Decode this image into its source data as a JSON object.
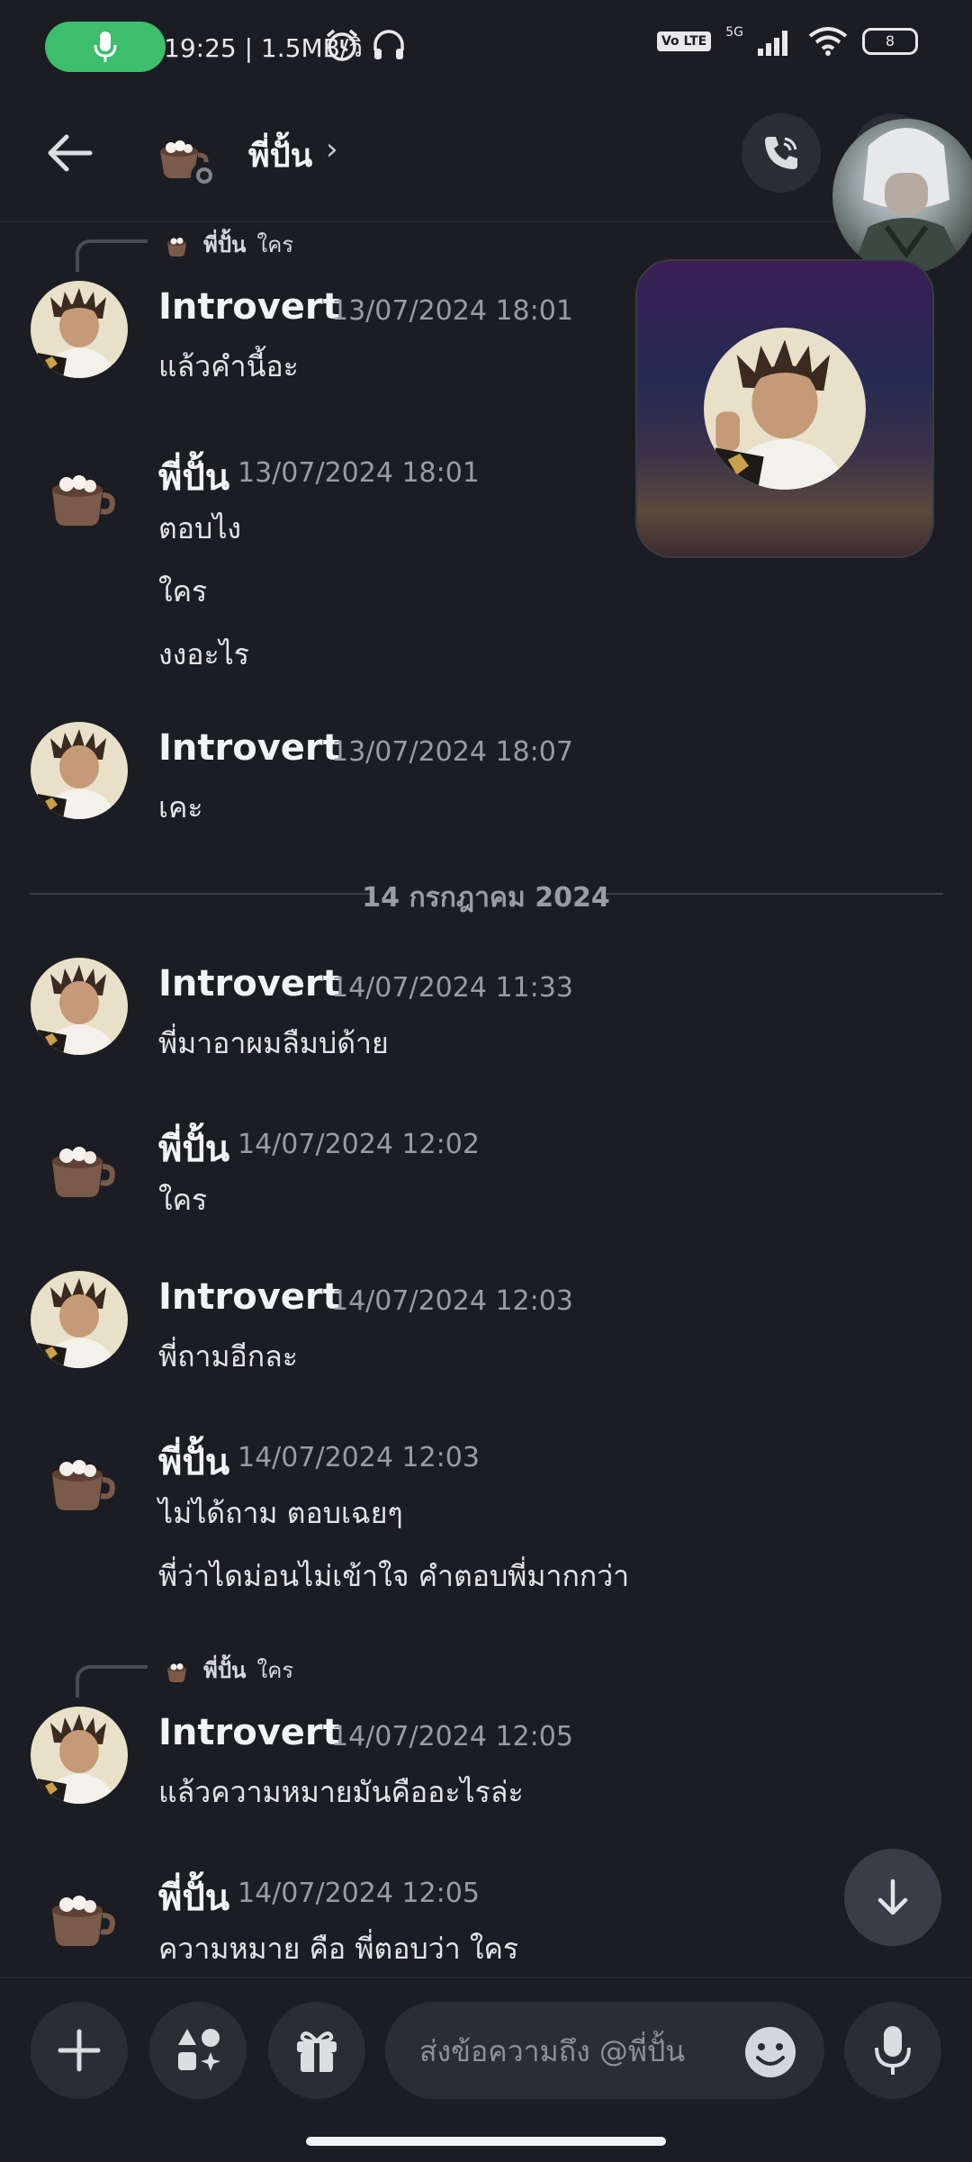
{
  "status_bar": {
    "time": "19:25 | 1.5MB/วิ",
    "network_badge": "Vo LTE",
    "network_type": "5G",
    "battery": "8"
  },
  "header": {
    "name": "พี่ปั้น",
    "chevron": "›"
  },
  "reply_refs": {
    "first": {
      "name": "พี่ปั้น",
      "text": "ใคร"
    },
    "second": {
      "name": "พี่ปั้น",
      "text": "ใคร"
    }
  },
  "messages": [
    {
      "author": "Introvert",
      "time": "13/07/2024 18:01",
      "lines": [
        "แล้วคำนี้อะ"
      ]
    },
    {
      "author": "พี่ปั้น",
      "time": "13/07/2024 18:01",
      "lines": [
        "ตอบไง",
        "ใคร",
        "งงอะไร"
      ]
    },
    {
      "author": "Introvert",
      "time": "13/07/2024 18:07",
      "lines": [
        "เคะ"
      ]
    },
    {
      "author": "Introvert",
      "time": "14/07/2024 11:33",
      "lines": [
        "พี่มาอาผมลืมบ่ด้าย"
      ]
    },
    {
      "author": "พี่ปั้น",
      "time": "14/07/2024 12:02",
      "lines": [
        "ใคร"
      ]
    },
    {
      "author": "Introvert",
      "time": "14/07/2024 12:03",
      "lines": [
        "พี่ถามอีกละ"
      ]
    },
    {
      "author": "พี่ปั้น",
      "time": "14/07/2024 12:03",
      "lines": [
        "ไม่ได้ถาม ตอบเฉยๆ",
        "พี่ว่าไดม่อนไม่เข้าใจ คำตอบพี่มากกว่า"
      ]
    },
    {
      "author": "Introvert",
      "time": "14/07/2024 12:05",
      "lines": [
        "แล้วความหมายมันคืออะไรล่ะ"
      ]
    },
    {
      "author": "พี่ปั้น",
      "time": "14/07/2024 12:05",
      "lines": [
        "ความหมาย คือ พี่ตอบว่า ใคร"
      ]
    }
  ],
  "date_divider": "14 กรกฎาคม 2024",
  "composer": {
    "placeholder": "ส่งข้อความถึง @พี่ปั้น"
  },
  "colors": {
    "background": "#1c1d22",
    "mic_active": "#3ebd6c",
    "timestamp": "#9a9ba3"
  },
  "icons": [
    "microphone-icon",
    "alarm-icon",
    "headphones-icon",
    "signal-icon",
    "wifi-icon",
    "battery-icon",
    "back-arrow-icon",
    "phone-call-icon",
    "chevron-right-icon",
    "plus-icon",
    "apps-icon",
    "gift-icon",
    "emoji-icon",
    "arrow-down-icon"
  ]
}
